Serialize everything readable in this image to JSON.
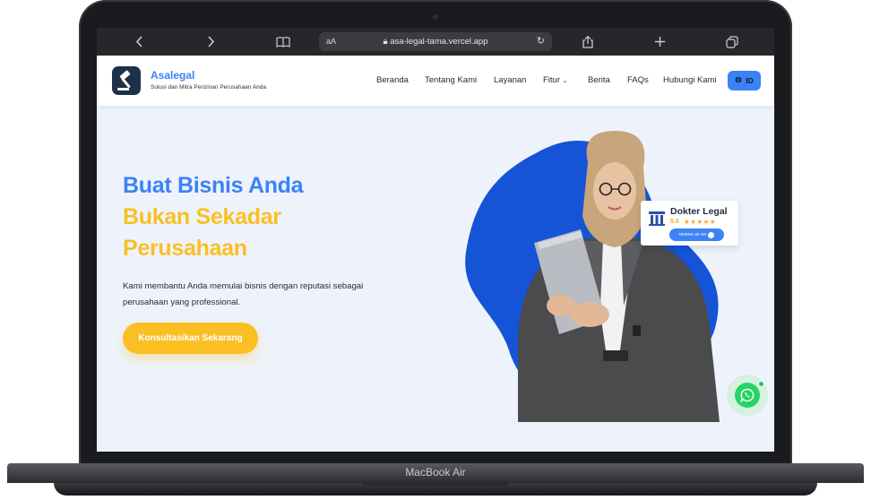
{
  "browser": {
    "back_icon": "chevron-left-icon",
    "forward_icon": "chevron-right-icon",
    "reader_label": "aA",
    "url": "asa-legal-tama.vercel.app",
    "reload_icon": "reload-icon",
    "share_icon": "share-icon",
    "new_tab_icon": "plus-icon",
    "tabs_icon": "tabs-icon"
  },
  "site": {
    "brand_name": "Asalegal",
    "brand_tagline": "Solusi dan Mitra Perizinan Perusahaan Anda",
    "nav": [
      {
        "label": "Beranda"
      },
      {
        "label": "Tentang Kami"
      },
      {
        "label": "Layanan"
      },
      {
        "label": "Fitur"
      },
      {
        "label": "Berita"
      },
      {
        "label": "FAQs"
      },
      {
        "label": "Hubungi Kami"
      }
    ],
    "language": "ID"
  },
  "hero": {
    "line1": "Buat Bisnis Anda",
    "line2": "Bukan Sekadar",
    "line3": "Perusahaan",
    "description": "Kami membantu Anda memulai bisnis dengan reputasi sebagai perusahaan yang professional.",
    "cta": "Konsultasikan Sekarang"
  },
  "review_badge": {
    "title": "Dokter Legal",
    "score": "5.0",
    "stars": "★★★★★",
    "button": "review us on"
  },
  "device": {
    "model": "MacBook Air"
  },
  "colors": {
    "primary_blue": "#3b82f6",
    "accent_yellow": "#fbbf24",
    "blob_blue": "#1554d6",
    "whatsapp_green": "#25d366"
  }
}
